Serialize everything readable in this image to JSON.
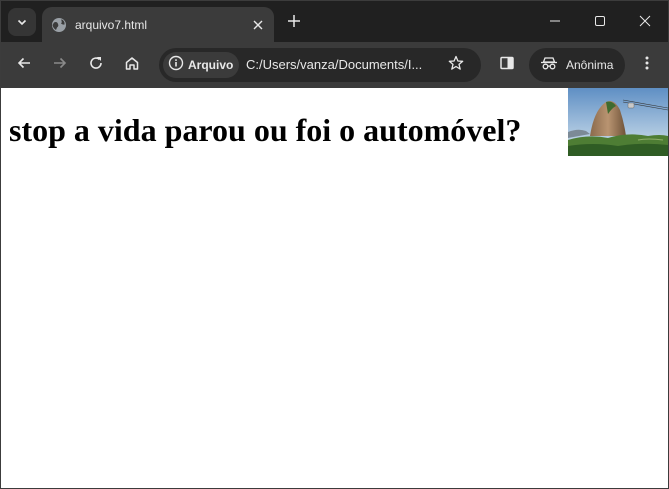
{
  "browser": {
    "tab": {
      "title": "arquivo7.html"
    },
    "address_bar": {
      "security_chip_label": "Arquivo",
      "url": "C:/Users/vanza/Documents/I..."
    },
    "profile": {
      "label": "Anônima"
    }
  },
  "page": {
    "heading": "stop a vida parou ou foi o automóvel?"
  },
  "icons": {
    "tab_search": "chevron-down-icon",
    "favicon": "globe-icon",
    "tab_close": "close-icon",
    "new_tab": "plus-icon",
    "back": "arrow-left-icon",
    "forward": "arrow-right-icon",
    "reload": "reload-icon",
    "home": "home-icon",
    "info": "info-icon",
    "bookmark": "star-icon",
    "side_panel": "side-panel-icon",
    "incognito": "incognito-icon",
    "menu": "more-vert-icon",
    "minimize": "minimize-icon",
    "maximize": "maximize-icon",
    "close_window": "close-window-icon"
  },
  "colors": {
    "frame": "#202020",
    "toolbar": "#3b3b3b",
    "omnibox": "#282828",
    "page_background": "#ffffff",
    "text_light": "#e8e8e8"
  }
}
